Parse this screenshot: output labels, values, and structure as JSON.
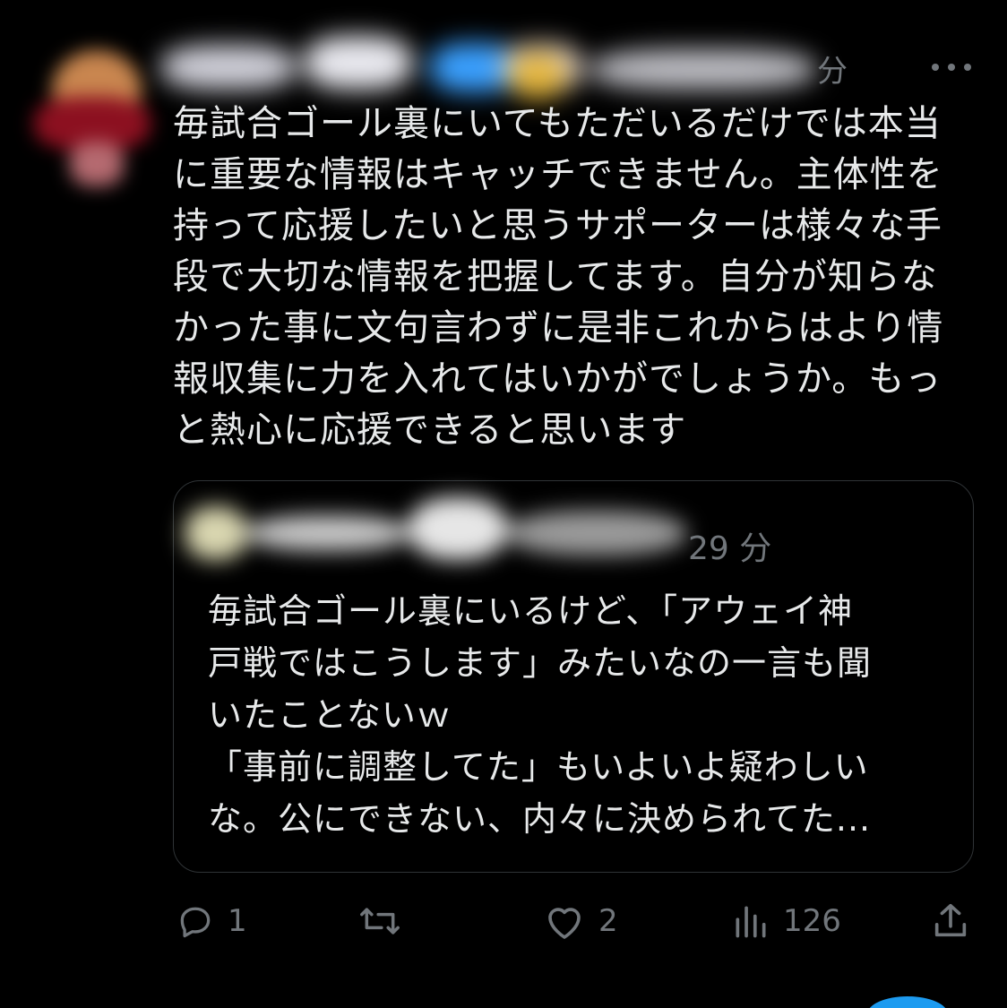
{
  "tweet": {
    "time": "分",
    "text": "毎試合ゴール裏にいてもただいるだけでは本当\nに重要な情報はキャッチできません。主体性を\n持って応援したいと思うサポーターは様々な手\n段で大切な情報を把握してます。自分が知らな\nかった事に文句言わずに是非これからはより情\n報収集に力を入れてはいかがでしょうか。もっ\nと熱心に応援できると思います"
  },
  "quote": {
    "time": "29 分",
    "text": "毎試合ゴール裏にいるけど、「アウェイ神\n戸戦ではこうします」みたいなの一言も聞\nいたことないｗ\n「事前に調整してた」もいよいよ疑わしい\nな。公にできない、内々に決められてた..."
  },
  "actions": {
    "reply_count": "1",
    "retweet_count": "",
    "like_count": "2",
    "views_count": "126"
  },
  "icons": {
    "more": "more-icon",
    "reply": "reply-icon",
    "retweet": "retweet-icon",
    "like": "heart-icon",
    "views": "views-icon",
    "share": "share-icon"
  },
  "colors": {
    "background": "#000000",
    "text": "#e7e9ea",
    "secondary": "#71767b",
    "border": "#2f3336",
    "accent": "#1d9bf0"
  }
}
